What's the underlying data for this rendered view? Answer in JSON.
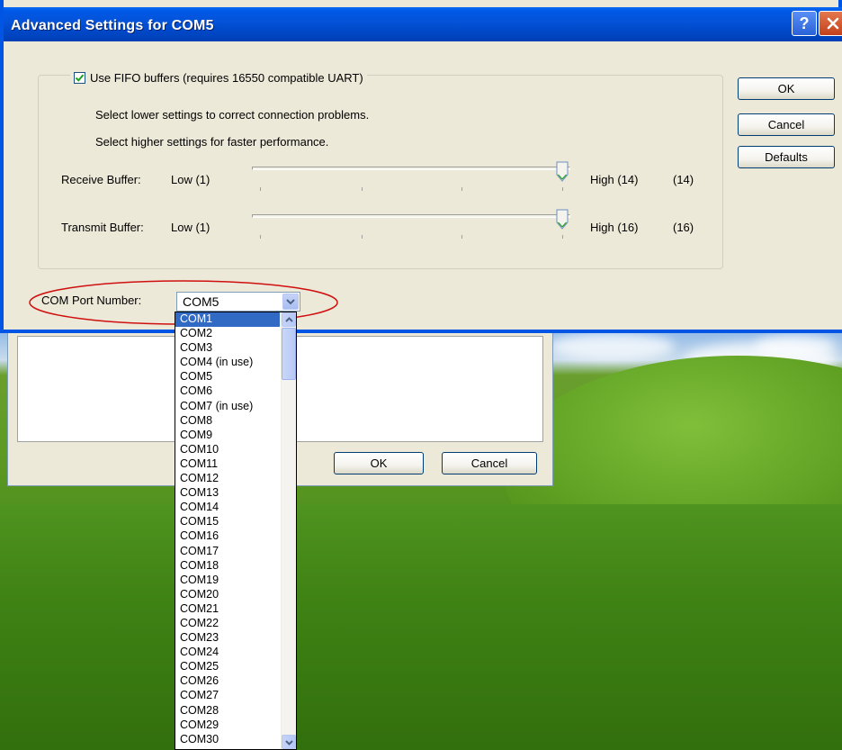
{
  "window": {
    "title": "Advanced Settings for COM5",
    "help_icon": "question-mark-icon",
    "close_icon": "close-x-icon"
  },
  "fifo": {
    "checkbox_label": "Use FIFO buffers (requires 16550 compatible UART)",
    "checked": true,
    "hint_lower": "Select lower settings to correct connection problems.",
    "hint_higher": "Select higher settings for faster performance."
  },
  "receive_buffer": {
    "label": "Receive Buffer:",
    "low_label": "Low (1)",
    "high_label": "High (14)",
    "current_label": "(14)",
    "value": 14,
    "max": 14
  },
  "transmit_buffer": {
    "label": "Transmit Buffer:",
    "low_label": "Low (1)",
    "high_label": "High (16)",
    "current_label": "(16)",
    "value": 16,
    "max": 16
  },
  "buttons": {
    "ok": "OK",
    "cancel": "Cancel",
    "defaults": "Defaults"
  },
  "com_port": {
    "label": "COM Port Number:",
    "selected_value": "COM5",
    "highlighted_item": "COM1",
    "options": [
      "COM1",
      "COM2",
      "COM3",
      "COM4 (in use)",
      "COM5",
      "COM6",
      "COM7 (in use)",
      "COM8",
      "COM9",
      "COM10",
      "COM11",
      "COM12",
      "COM13",
      "COM14",
      "COM15",
      "COM16",
      "COM17",
      "COM18",
      "COM19",
      "COM20",
      "COM21",
      "COM22",
      "COM23",
      "COM24",
      "COM25",
      "COM26",
      "COM27",
      "COM28",
      "COM29",
      "COM30"
    ]
  },
  "back_dialog": {
    "ok": "OK",
    "cancel": "Cancel"
  },
  "colors": {
    "titlebar": "#0054e3",
    "dialog_bg": "#ece9d8",
    "selection": "#316ac5",
    "annotation_ellipse": "#d01010"
  }
}
